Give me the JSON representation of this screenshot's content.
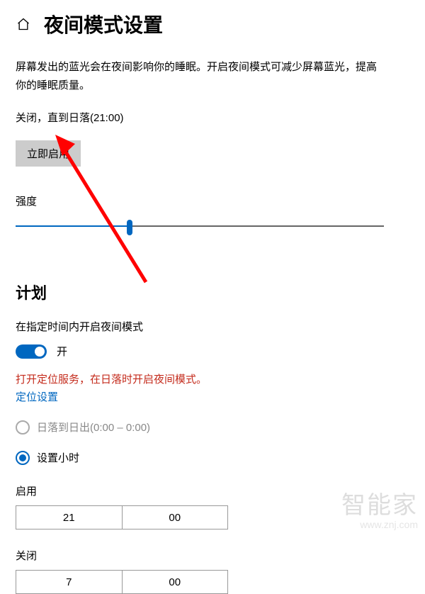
{
  "header": {
    "title": "夜间模式设置"
  },
  "description": "屏幕发出的蓝光会在夜间影响你的睡眠。开启夜间模式可减少屏幕蓝光，提高你的睡眠质量。",
  "status_text": "关闭，直到日落(21:00)",
  "button": {
    "apply_now": "立即启用"
  },
  "strength": {
    "label": "强度",
    "value_percent": 31
  },
  "plan": {
    "title": "计划",
    "schedule_label": "在指定时间内开启夜间模式",
    "toggle_state": "开",
    "location_warning": "打开定位服务，在日落时开启夜间模式。",
    "location_link": "定位设置",
    "radio_sunset": "日落到日出(0:00 – 0:00)",
    "radio_hours": "设置小时",
    "on_label": "启用",
    "on_hour": "21",
    "on_minute": "00",
    "off_label": "关闭",
    "off_hour": "7",
    "off_minute": "00"
  },
  "watermark": {
    "line1": "智能家",
    "line2": "www.znj.com"
  }
}
